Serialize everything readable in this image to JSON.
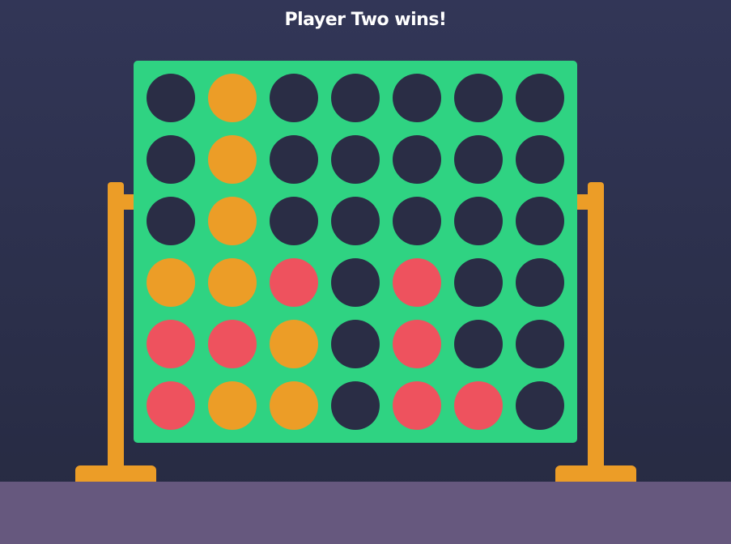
{
  "status": {
    "message": "Player Two wins!"
  },
  "colors": {
    "empty": "#2a2d45",
    "player_one": "#ee525e",
    "player_two": "#ec9d27",
    "board": "#2fd382",
    "stand": "#ec9d27",
    "floor": "#66587e"
  },
  "board": {
    "rows": 6,
    "columns": 7,
    "cells": [
      [
        "empty",
        "two",
        "empty",
        "empty",
        "empty",
        "empty",
        "empty"
      ],
      [
        "empty",
        "two",
        "empty",
        "empty",
        "empty",
        "empty",
        "empty"
      ],
      [
        "empty",
        "two",
        "empty",
        "empty",
        "empty",
        "empty",
        "empty"
      ],
      [
        "two",
        "two",
        "one",
        "empty",
        "one",
        "empty",
        "empty"
      ],
      [
        "one",
        "one",
        "two",
        "empty",
        "one",
        "empty",
        "empty"
      ],
      [
        "one",
        "two",
        "two",
        "empty",
        "one",
        "one",
        "empty"
      ]
    ]
  }
}
